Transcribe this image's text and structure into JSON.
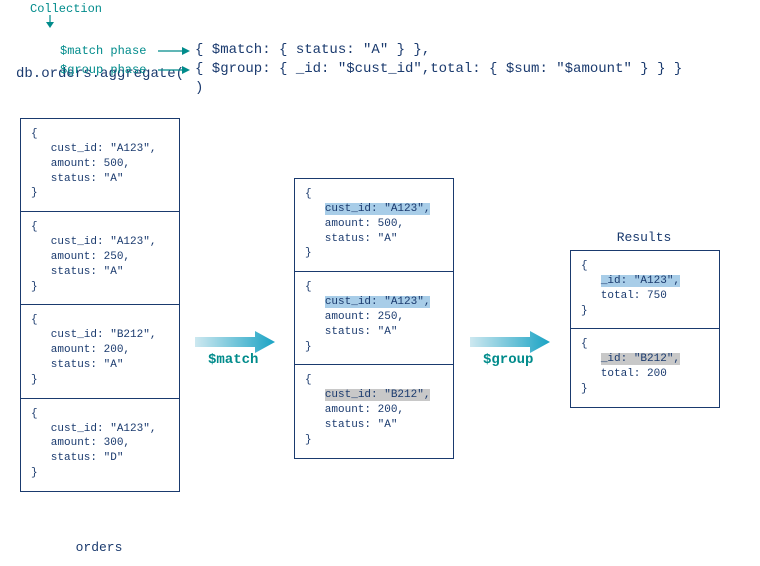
{
  "annotations": {
    "collection": "Collection",
    "match_phase": "$match phase",
    "group_phase": "$group phase"
  },
  "code": {
    "line1_pre": "db.",
    "line1_coll": "orders",
    "line1_post": ".aggregate(",
    "line2": "{ $match: { status: \"A\" } },",
    "line3": "{ $group: { _id: \"$cust_id\",total: { $sum: \"$amount\" } } }",
    "line4": ")"
  },
  "columns": {
    "orders_label": "orders",
    "results_label": "Results",
    "orders": [
      "{\n   cust_id: \"A123\",\n   amount: 500,\n   status: \"A\"\n}",
      "{\n   cust_id: \"A123\",\n   amount: 250,\n   status: \"A\"\n}",
      "{\n   cust_id: \"B212\",\n   amount: 200,\n   status: \"A\"\n}",
      "{\n   cust_id: \"A123\",\n   amount: 300,\n   status: \"D\"\n}"
    ],
    "matched": [
      {
        "pre": "{\n   ",
        "hl": "cust_id: \"A123\",",
        "hlClass": "hl-blue",
        "post": "\n   amount: 500,\n   status: \"A\"\n}"
      },
      {
        "pre": "{\n   ",
        "hl": "cust_id: \"A123\",",
        "hlClass": "hl-blue",
        "post": "\n   amount: 250,\n   status: \"A\"\n}"
      },
      {
        "pre": "{\n   ",
        "hl": "cust_id: \"B212\",",
        "hlClass": "hl-gray",
        "post": "\n   amount: 200,\n   status: \"A\"\n}"
      }
    ],
    "results": [
      {
        "pre": "{\n   ",
        "hl": "_id: \"A123\",",
        "hlClass": "hl-blue",
        "post": "\n   total: 750\n}"
      },
      {
        "pre": "{\n   ",
        "hl": "_id: \"B212\",",
        "hlClass": "hl-gray",
        "post": "\n   total: 200\n}"
      }
    ]
  },
  "arrows": {
    "match": "$match",
    "group": "$group"
  }
}
